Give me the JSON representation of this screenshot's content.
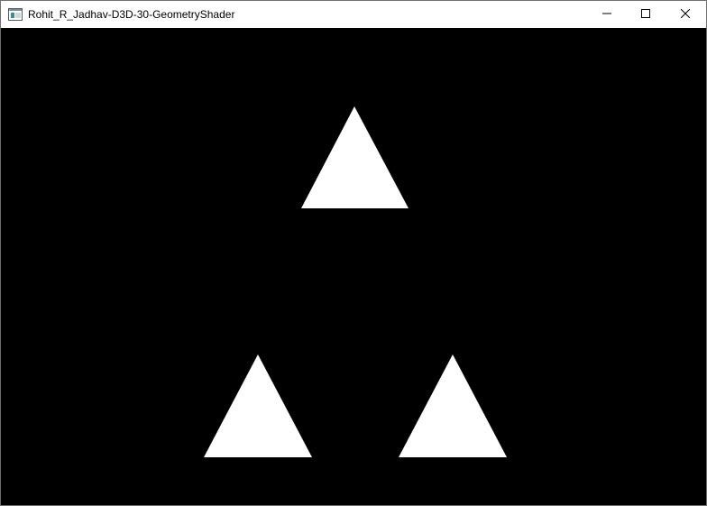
{
  "window": {
    "title": "Rohit_R_Jadhav-D3D-30-GeometryShader",
    "icons": {
      "app": "application-window-icon",
      "minimize": "minimize-icon",
      "maximize": "maximize-icon",
      "close": "close-icon"
    }
  },
  "scene": {
    "background_color": "#000000",
    "shape_color": "#ffffff",
    "shapes": [
      "triangle",
      "triangle",
      "triangle"
    ]
  }
}
